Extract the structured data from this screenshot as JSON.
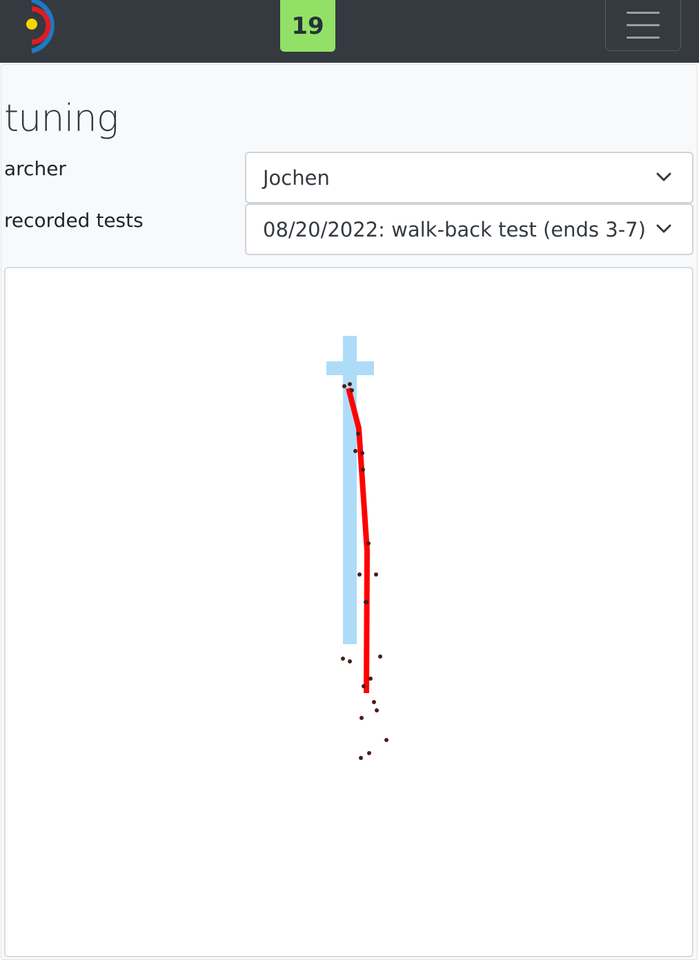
{
  "navbar": {
    "logo_icon": "archery-target-logo-icon",
    "badge": "19",
    "menu_icon": "hamburger-menu-icon",
    "colors": {
      "background": "#343a40",
      "badge": "#92e166"
    }
  },
  "page": {
    "title": "tuning",
    "archer": {
      "label": "archer",
      "selected": "Jochen"
    },
    "recorded_tests": {
      "label": "recorded tests",
      "selected": "08/20/2022: walk-back test (ends 3-7)"
    }
  },
  "chart_data": {
    "type": "scatter",
    "title": "",
    "xlabel": "",
    "ylabel": "",
    "colors": {
      "reference": "#aedcf8",
      "trend": "#ff0000",
      "points": "#4a1c1c"
    },
    "reference_cross": {
      "vertical": {
        "x_range": [
          -10,
          10
        ],
        "y_range": [
          -37,
          410
        ]
      },
      "horizontal": {
        "x_range": [
          -34,
          35
        ],
        "y_range": [
          0,
          20
        ]
      }
    },
    "trend_line": {
      "x": [
        -2,
        13,
        25,
        24
      ],
      "y": [
        39,
        97,
        275,
        481
      ]
    },
    "points": {
      "x": [
        -8,
        0,
        3,
        12,
        8,
        18,
        19,
        27,
        14,
        38,
        24,
        23,
        -10,
        0,
        44,
        20,
        30,
        35,
        39,
        17,
        28,
        16,
        53
      ],
      "y": [
        36,
        33,
        42,
        105,
        130,
        133,
        157,
        264,
        309,
        309,
        349,
        349,
        431,
        435,
        428,
        471,
        460,
        494,
        506,
        517,
        568,
        575,
        549
      ]
    }
  }
}
